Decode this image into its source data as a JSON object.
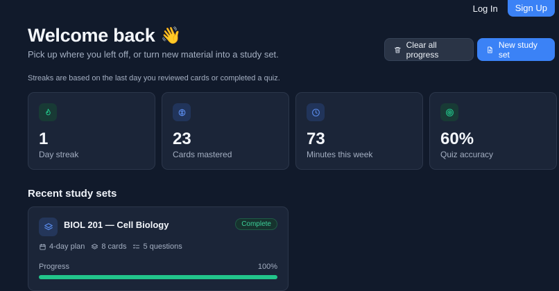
{
  "header": {
    "login_label": "Log In",
    "signup_label": "Sign Up"
  },
  "hero": {
    "title": "Welcome back",
    "emoji": "👋",
    "subtitle": "Pick up where you left off, or turn new material into a study set.",
    "note": "Streaks are based on the last day you reviewed cards or completed a quiz."
  },
  "actions": {
    "clear_label": "Clear all progress",
    "new_label": "New study set"
  },
  "stats": [
    {
      "value": "1",
      "label": "Day streak",
      "icon": "flame-icon",
      "color": "#22c58b",
      "bg": "#183a35"
    },
    {
      "value": "23",
      "label": "Cards mastered",
      "icon": "brain-icon",
      "color": "#5b8def",
      "bg": "#21345a"
    },
    {
      "value": "73",
      "label": "Minutes this week",
      "icon": "clock-icon",
      "color": "#5b8def",
      "bg": "#21345a"
    },
    {
      "value": "60%",
      "label": "Quiz accuracy",
      "icon": "target-icon",
      "color": "#22c58b",
      "bg": "#183a35"
    }
  ],
  "recent": {
    "section_title": "Recent study sets",
    "sets": [
      {
        "title": "BIOL 201 — Cell Biology",
        "status": "Complete",
        "plan": "4-day plan",
        "cards": "8 cards",
        "questions": "5 questions",
        "progress_label": "Progress",
        "progress_text": "100%",
        "progress": 1.0
      }
    ]
  },
  "colors": {
    "accent": "#3b82f6",
    "success": "#22c58b",
    "background": "#111a2b",
    "card": "#1b2538"
  }
}
